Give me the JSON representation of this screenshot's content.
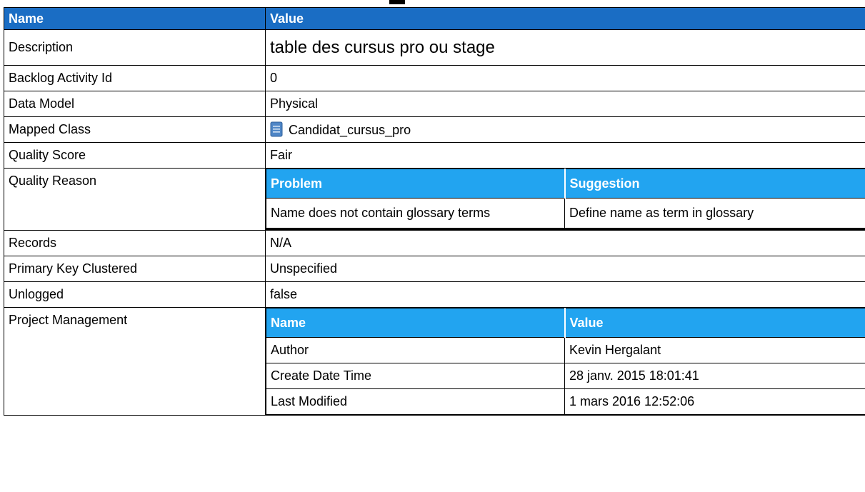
{
  "header": {
    "name_label": "Name",
    "value_label": "Value"
  },
  "rows": {
    "description": {
      "name": "Description",
      "value": "table des cursus pro ou stage"
    },
    "backlog": {
      "name": "Backlog Activity Id",
      "value": "0"
    },
    "data_model": {
      "name": "Data Model",
      "value": "Physical"
    },
    "mapped_class": {
      "name": "Mapped Class",
      "value": "Candidat_cursus_pro",
      "icon": "class-icon"
    },
    "quality_score": {
      "name": "Quality Score",
      "value": "Fair"
    },
    "quality_reason": {
      "name": "Quality Reason",
      "columns": [
        "Problem",
        "Suggestion"
      ],
      "entries": [
        {
          "problem": "Name does not contain glossary terms",
          "suggestion": "Define name as term in glossary"
        }
      ]
    },
    "records": {
      "name": "Records",
      "value": "N/A"
    },
    "pk_clustered": {
      "name": "Primary Key Clustered",
      "value": "Unspecified"
    },
    "unlogged": {
      "name": "Unlogged",
      "value": "false"
    },
    "project_management": {
      "name": "Project Management",
      "columns": [
        "Name",
        "Value"
      ],
      "entries": [
        {
          "name": "Author",
          "value": "Kevin Hergalant"
        },
        {
          "name": "Create Date Time",
          "value": "28 janv. 2015 18:01:41"
        },
        {
          "name": "Last Modified",
          "value": "1 mars 2016 12:52:06"
        }
      ]
    }
  },
  "colors": {
    "header_blue": "#1a6dc4",
    "subheader_blue": "#22a4f0"
  }
}
